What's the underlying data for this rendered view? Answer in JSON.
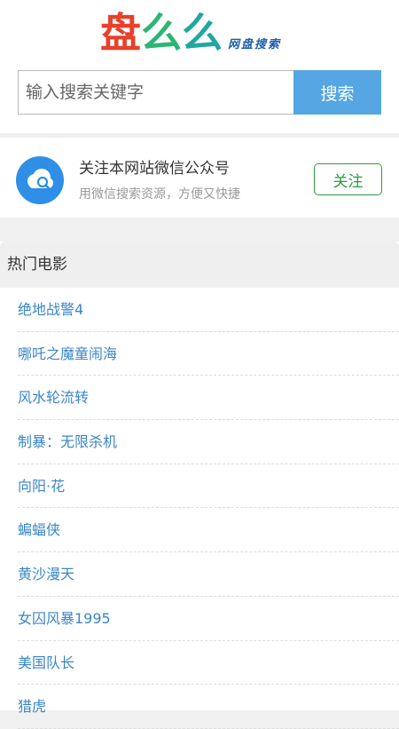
{
  "logo": {
    "chars": [
      {
        "text": "盘",
        "color": "#e8402a"
      },
      {
        "text": "么",
        "color": "#2bb673"
      },
      {
        "text": "么",
        "color": "#1fa7a0"
      }
    ],
    "subtitle": "网盘搜索"
  },
  "search": {
    "placeholder": "输入搜索关键字",
    "button_label": "搜索"
  },
  "follow": {
    "title": "关注本网站微信公众号",
    "subtitle": "用微信搜索资源，方便又快捷",
    "button_label": "关注",
    "icon": "cloud-search-icon"
  },
  "hot": {
    "title": "热门电影",
    "items": [
      "绝地战警4",
      "哪吒之魔童闹海",
      "风水轮流转",
      "制暴：无限杀机",
      "向阳·花",
      "蝙蝠侠",
      "黄沙漫天",
      "女囚风暴1995",
      "美国队长",
      "猎虎"
    ]
  },
  "colors": {
    "accent": "#55a6e2",
    "follow_green": "#2e9a3e",
    "link_blue": "#3a86c8"
  }
}
